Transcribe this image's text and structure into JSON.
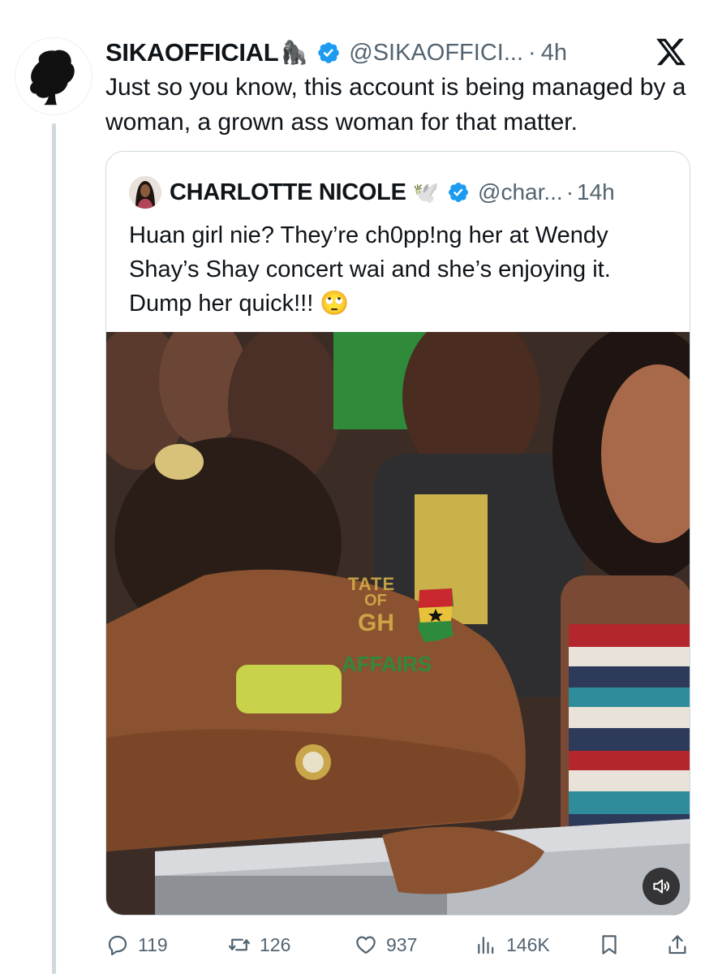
{
  "tweet": {
    "author": {
      "display_name": "SIKAOFFICIAL",
      "name_emoji": "🦍",
      "handle": "@SIKAOFFICI...",
      "time": "4h",
      "separator": "·",
      "verified_color": "#1d9bf0"
    },
    "text": "Just so you know, this account is being managed by a woman, a grown ass woman for that matter.",
    "close_icon": "x-logo-icon"
  },
  "quote": {
    "author": {
      "display_name": "CHARLOTTE NICOLE",
      "name_emoji": "🕊️",
      "handle": "@char...",
      "time": "14h",
      "separator": "·"
    },
    "text": "Huan girl nie? They’re ch0pp!ng her at Wendy Shay’s Shay concert wai and she’s enjoying it. Dump her quick!!! 🙄",
    "media": {
      "watermark": {
        "line1": "TATE",
        "line2": "OF",
        "line3": "GH",
        "line4": "AFFAIRS"
      },
      "audio_icon": "speaker-icon"
    }
  },
  "actions": {
    "replies": "119",
    "reposts": "126",
    "likes": "937",
    "views": "146K"
  },
  "colors": {
    "text_primary": "#0f1419",
    "text_secondary": "#536471",
    "border": "#cfd9de",
    "verified": "#1d9bf0"
  }
}
